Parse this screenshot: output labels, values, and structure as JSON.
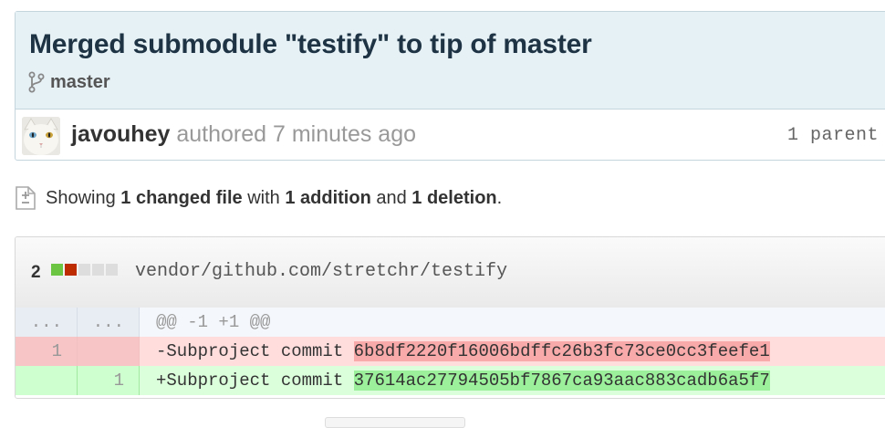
{
  "commit": {
    "title": "Merged submodule \"testify\" to tip of master",
    "branch": "master",
    "author": "javouhey",
    "authored_text": "authored 7 minutes ago",
    "parent_text": "1 parent"
  },
  "summary": {
    "prefix": "Showing ",
    "files": "1 changed file",
    "mid1": " with ",
    "additions": "1 addition",
    "mid2": " and ",
    "deletions": "1 deletion",
    "suffix": "."
  },
  "file": {
    "change_count": "2",
    "path": "vendor/github.com/stretchr/testify",
    "diffstat_blocks": [
      "add",
      "del",
      "neutral",
      "neutral",
      "neutral"
    ]
  },
  "diff": {
    "hunk": {
      "old": "...",
      "new": "...",
      "text": "@@ -1 +1 @@"
    },
    "deleted": {
      "old": "1",
      "new": "",
      "prefix": "-Subproject commit ",
      "hash": "6b8df2220f16006bdffc26b3fc73ce0cc3feefe1"
    },
    "added": {
      "old": "",
      "new": "1",
      "prefix": "+Subproject commit ",
      "hash": "37614ac27794505bf7867ca93aac883cadb6a5f7"
    }
  },
  "colors": {
    "title_bg": "#e6f1f6",
    "addition_green": "#6cc644",
    "deletion_red": "#bd2c00"
  },
  "icons": {
    "branch": "branch-icon",
    "file_diff": "file-diff-icon",
    "avatar": "avatar-cat"
  }
}
